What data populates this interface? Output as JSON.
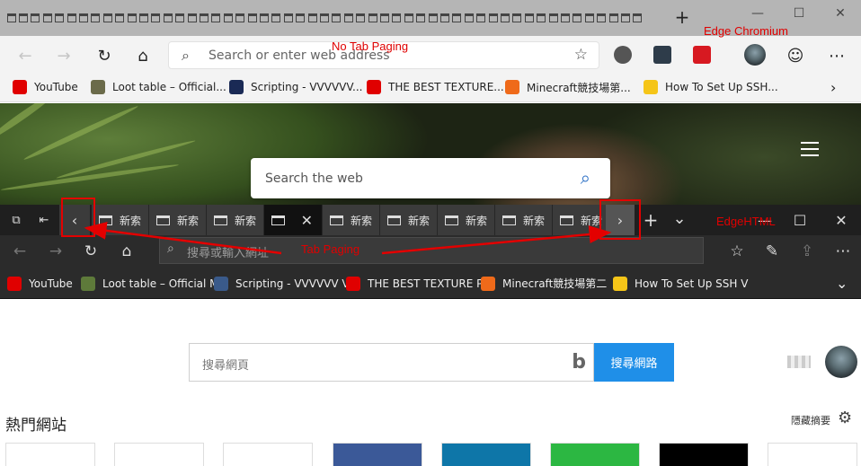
{
  "chromium": {
    "new_tab_symbol": "+",
    "window_controls": {
      "minimize": "—",
      "maximize": "☐",
      "close": "✕"
    },
    "nav": {
      "back": "←",
      "forward": "→",
      "refresh": "↻",
      "home": "⌂"
    },
    "address_placeholder": "Search or enter web address",
    "bookmarks": [
      {
        "label": "YouTube",
        "color": "#e00000"
      },
      {
        "label": "Loot table – Official...",
        "color": "#6b6b4a"
      },
      {
        "label": "Scripting - VVVVVV...",
        "color": "#1a2a55"
      },
      {
        "label": "THE BEST TEXTURE...",
        "color": "#e00000"
      },
      {
        "label": "Minecraft競技場第...",
        "color": "#ef6a1a"
      },
      {
        "label": "How To Set Up SSH...",
        "color": "#f5c518"
      }
    ],
    "bookmarks_more": "›",
    "smiley": "☺",
    "more": "⋯"
  },
  "annotations": {
    "no_tab_paging": "No Tab Paging",
    "edge_chromium": "Edge Chromium",
    "edgehtml": "EdgeHTML",
    "tab_paging": "Tab Paging"
  },
  "hero": {
    "search_placeholder": "Search the web"
  },
  "edgehtml": {
    "tabs": [
      {
        "label": "新索"
      },
      {
        "label": "新索"
      },
      {
        "label": "新索"
      },
      {
        "label": "",
        "active": true
      },
      {
        "label": "新索"
      },
      {
        "label": "新索"
      },
      {
        "label": "新索"
      },
      {
        "label": "新索"
      },
      {
        "label": "新索"
      }
    ],
    "scroll_left": "‹",
    "scroll_right": "›",
    "new_tab": "+",
    "tab_list": "⌄",
    "window_controls": {
      "minimize": "—",
      "maximize": "☐",
      "close": "✕"
    },
    "address_placeholder": "搜尋或輸入網址",
    "bookmarks": [
      {
        "label": "YouTube",
        "color": "#e00000"
      },
      {
        "label": "Loot table – Official M",
        "color": "#5e7a3a"
      },
      {
        "label": "Scripting - VVVVVV V",
        "color": "#3a5a8a"
      },
      {
        "label": "THE BEST TEXTURE P",
        "color": "#e00000"
      },
      {
        "label": "Minecraft競技場第二",
        "color": "#ef6a1a"
      },
      {
        "label": "How To Set Up SSH V",
        "color": "#f5c518"
      }
    ],
    "bookmarks_more": "⌄",
    "ntp": {
      "search_placeholder": "搜尋網頁",
      "search_button": "搜尋網路",
      "bing_logo": "b",
      "top_sites_title": "熱門網站",
      "hide_digest": "隱藏摘要",
      "gear": "⚙",
      "tile_colors": [
        "#ffffff",
        "#ffffff",
        "#ffffff",
        "#3b5998",
        "#0e76a8",
        "#2cb742",
        "#000000",
        "#ffffff"
      ]
    }
  }
}
